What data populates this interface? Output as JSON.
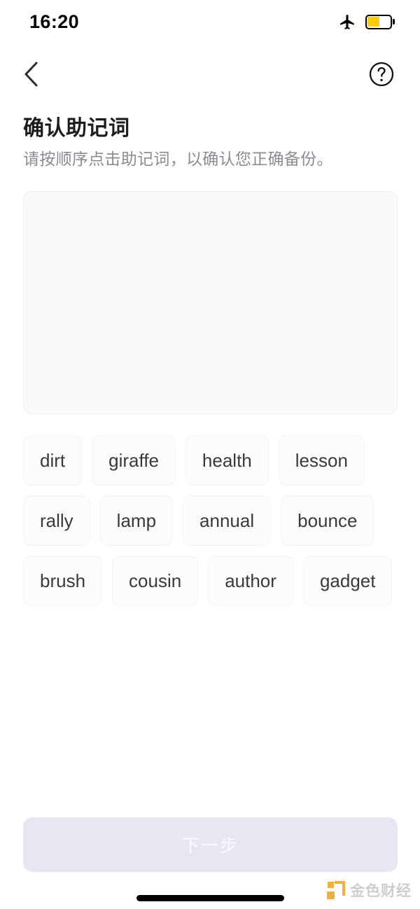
{
  "status_bar": {
    "time": "16:20",
    "airplane_icon": "airplane-mode-icon",
    "battery_icon": "battery-icon",
    "battery_color": "#FFCC00",
    "battery_level_percent": 50
  },
  "nav": {
    "back_icon": "chevron-left-icon",
    "help_icon": "question-circle-icon"
  },
  "heading": {
    "title": "确认助记词",
    "subtitle": "请按顺序点击助记词，以确认您正确备份。"
  },
  "answer_panel": {
    "selected_words": [],
    "background_color": "#fafafa"
  },
  "word_pool": {
    "words": [
      "dirt",
      "giraffe",
      "health",
      "lesson",
      "rally",
      "lamp",
      "annual",
      "bounce",
      "brush",
      "cousin",
      "author",
      "gadget"
    ]
  },
  "footer": {
    "next_label": "下一步",
    "next_enabled": false,
    "next_color": "#e7e7f3"
  },
  "watermark": {
    "text": "金色财经",
    "accent_color": "#F5A623"
  }
}
